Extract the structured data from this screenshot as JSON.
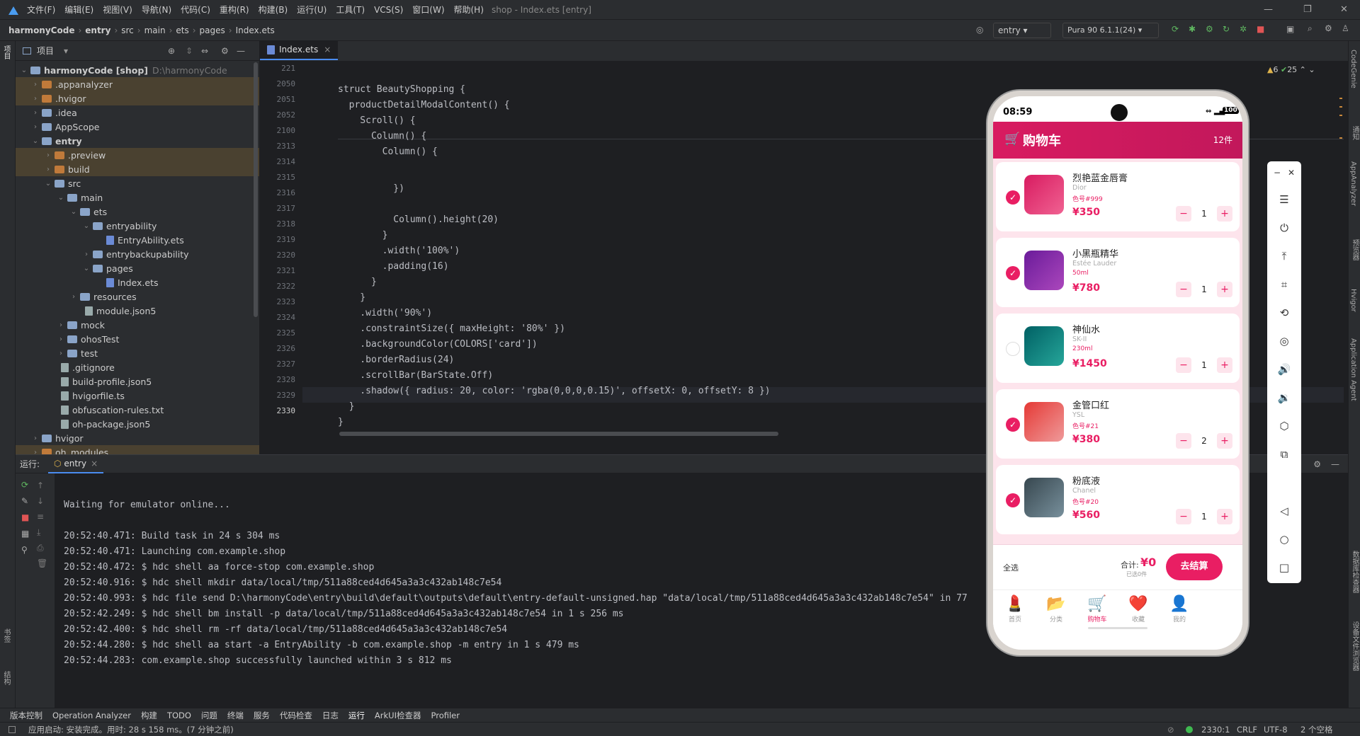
{
  "menu": {
    "items": [
      "文件(F)",
      "编辑(E)",
      "视图(V)",
      "导航(N)",
      "代码(C)",
      "重构(R)",
      "构建(B)",
      "运行(U)",
      "工具(T)",
      "VCS(S)",
      "窗口(W)",
      "帮助(H)"
    ],
    "title": "shop - Index.ets [entry]"
  },
  "nav": {
    "crumbs": [
      "harmonyCode",
      "entry",
      "src",
      "main",
      "ets",
      "pages",
      "Index.ets"
    ],
    "run_config": "entry",
    "device": "Pura 90 6.1.1(24)"
  },
  "project": {
    "title": "项目",
    "root_name": "harmonyCode [shop]",
    "root_path": "D:\\harmonyCode",
    "tree": [
      {
        "label": ".appanalyzer",
        "hl": true
      },
      {
        "label": ".hvigor",
        "hl": true
      },
      {
        "label": ".idea"
      },
      {
        "label": "AppScope"
      },
      {
        "label": "entry"
      },
      {
        "label": ".preview",
        "hl": true
      },
      {
        "label": "build",
        "hl": true
      },
      {
        "label": "src"
      },
      {
        "label": "main"
      },
      {
        "label": "ets"
      },
      {
        "label": "entryability"
      },
      {
        "label": "EntryAbility.ets"
      },
      {
        "label": "entrybackupability"
      },
      {
        "label": "pages"
      },
      {
        "label": "Index.ets"
      },
      {
        "label": "resources"
      },
      {
        "label": "module.json5"
      },
      {
        "label": "mock"
      },
      {
        "label": "ohosTest"
      },
      {
        "label": "test"
      },
      {
        "label": ".gitignore"
      },
      {
        "label": "build-profile.json5"
      },
      {
        "label": "hvigorfile.ts"
      },
      {
        "label": "obfuscation-rules.txt"
      },
      {
        "label": "oh-package.json5"
      },
      {
        "label": "hvigor"
      },
      {
        "label": "oh_modules",
        "hl": true
      }
    ]
  },
  "editor": {
    "tab": "Index.ets",
    "warnings": "6",
    "checks": "25",
    "sticky": [
      {
        "n": "221",
        "t": "struct BeautyShopping {"
      },
      {
        "n": "2050",
        "t": "  productDetailModalContent() {"
      },
      {
        "n": "2051",
        "t": "    Scroll() {"
      },
      {
        "n": "2052",
        "t": "      Column() {"
      },
      {
        "n": "2100",
        "t": "        Column() {"
      }
    ],
    "lines": [
      {
        "n": "2313",
        "t": "          })"
      },
      {
        "n": "2314",
        "t": ""
      },
      {
        "n": "2315",
        "t": "          Column().height(20)"
      },
      {
        "n": "2316",
        "t": "        }"
      },
      {
        "n": "2317",
        "t": "        .width('100%')"
      },
      {
        "n": "2318",
        "t": "        .padding(16)"
      },
      {
        "n": "2319",
        "t": "      }"
      },
      {
        "n": "2320",
        "t": "    }"
      },
      {
        "n": "2321",
        "t": "    .width('90%')"
      },
      {
        "n": "2322",
        "t": "    .constraintSize({ maxHeight: '80%' })"
      },
      {
        "n": "2323",
        "t": "    .backgroundColor(COLORS['card'])"
      },
      {
        "n": "2324",
        "t": "    .borderRadius(24)"
      },
      {
        "n": "2325",
        "t": "    .scrollBar(BarState.Off)"
      },
      {
        "n": "2326",
        "t": "    .shadow({ radius: 20, color: 'rgba(0,0,0,0.15)', offsetX: 0, offsetY: 8 })"
      },
      {
        "n": "2327",
        "t": "  }"
      },
      {
        "n": "2328",
        "t": "}"
      },
      {
        "n": "2329",
        "t": ""
      },
      {
        "n": "2330",
        "t": ""
      }
    ]
  },
  "run": {
    "label": "运行:",
    "tab": "entry",
    "console": [
      "Waiting for emulator online...",
      "",
      "20:52:40.471: Build task in 24 s 304 ms",
      "20:52:40.471: Launching com.example.shop",
      "20:52:40.472: $ hdc shell aa force-stop com.example.shop",
      "20:52:40.916: $ hdc shell mkdir data/local/tmp/511a88ced4d645a3a3c432ab148c7e54",
      "20:52:40.993: $ hdc file send D:\\harmonyCode\\entry\\build\\default\\outputs\\default\\entry-default-unsigned.hap \"data/local/tmp/511a88ced4d645a3a3c432ab148c7e54\" in 77",
      "20:52:42.249: $ hdc shell bm install -p data/local/tmp/511a88ced4d645a3a3c432ab148c7e54 in 1 s 256 ms",
      "20:52:42.400: $ hdc shell rm -rf data/local/tmp/511a88ced4d645a3a3c432ab148c7e54",
      "20:52:44.280: $ hdc shell aa start -a EntryAbility -b com.example.shop -m entry in 1 s 479 ms",
      "20:52:44.283: com.example.shop successfully launched within 3 s 812 ms"
    ]
  },
  "left_strip": {
    "top": "项目",
    "bottom1": "书签",
    "bottom2": "结构"
  },
  "right_strip": [
    "CodeGenie",
    "通知",
    "AppAnalyzer",
    "预览器",
    "Hvigor",
    "Application Agent",
    "数据库检查器",
    "设备文件浏览器"
  ],
  "bottom_tools": [
    "版本控制",
    "Operation Analyzer",
    "构建",
    "TODO",
    "问题",
    "终端",
    "服务",
    "代码检查",
    "日志",
    "运行",
    "ArkUI检查器",
    "Profiler"
  ],
  "status": {
    "left": "应用启动: 安装完成。用时: 28 s 158 ms。(7 分钟之前)",
    "pos": "2330:1",
    "eol": "CRLF",
    "enc": "UTF-8",
    "indent": "2 个空格"
  },
  "phone": {
    "time": "08:59",
    "battery": "100",
    "header_title": "购物车",
    "header_count": "12件",
    "items": [
      {
        "name": "烈艳蓝金唇膏",
        "brand": "Dior",
        "spec": "色号#999",
        "price": "¥350",
        "qty": "1",
        "checked": true,
        "color": "#d81b60"
      },
      {
        "name": "小黑瓶精华",
        "brand": "Estée Lauder",
        "spec": "50ml",
        "price": "¥780",
        "qty": "1",
        "checked": true,
        "color": "#7b1fa2"
      },
      {
        "name": "神仙水",
        "brand": "SK-II",
        "spec": "230ml",
        "price": "¥1450",
        "qty": "1",
        "checked": false,
        "color": "#00838f"
      },
      {
        "name": "金管口红",
        "brand": "YSL",
        "spec": "色号#21",
        "price": "¥380",
        "qty": "2",
        "checked": true,
        "color": "#e53935"
      },
      {
        "name": "粉底液",
        "brand": "Chanel",
        "spec": "色号#20",
        "price": "¥560",
        "qty": "1",
        "checked": true,
        "color": "#455a64"
      }
    ],
    "select_all": "全选",
    "total_label": "合计:",
    "total": "¥0",
    "selected_text": "已选0件",
    "checkout": "去结算",
    "nav": [
      "首页",
      "分类",
      "购物车",
      "收藏",
      "我的"
    ]
  }
}
